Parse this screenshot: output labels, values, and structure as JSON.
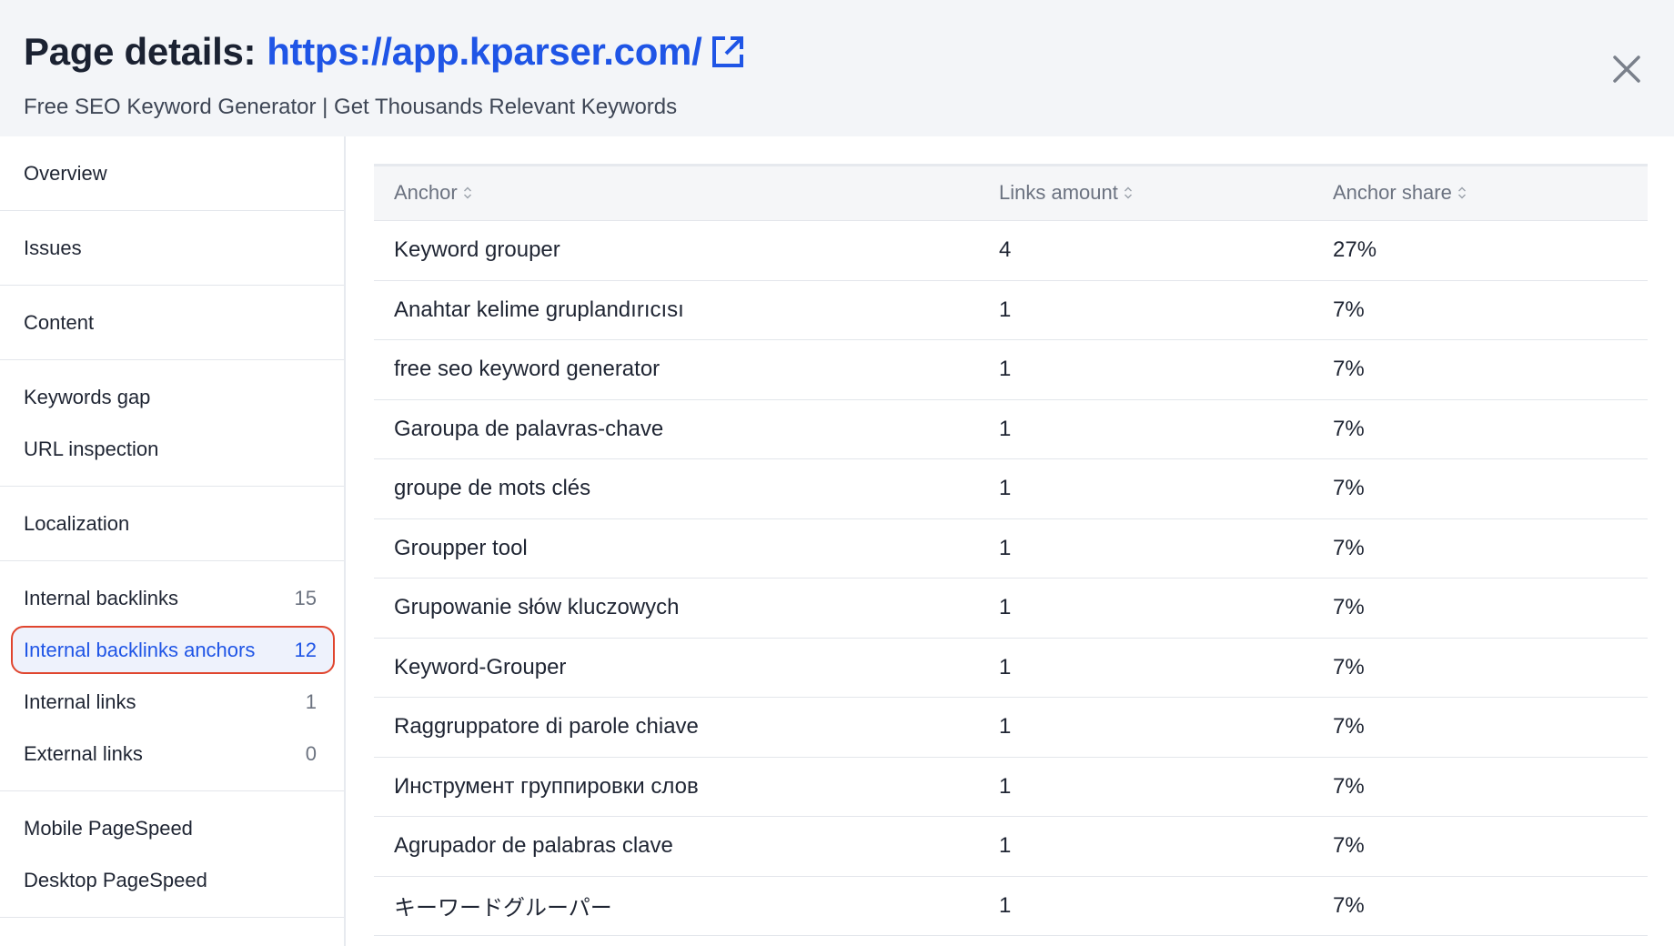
{
  "header": {
    "title_label": "Page details:",
    "url": "https://app.kparser.com/",
    "subtitle": "Free SEO Keyword Generator | Get Thousands Relevant Keywords"
  },
  "sidebar": {
    "groups": [
      [
        {
          "label": "Overview"
        }
      ],
      [
        {
          "label": "Issues"
        }
      ],
      [
        {
          "label": "Content"
        }
      ],
      [
        {
          "label": "Keywords gap"
        },
        {
          "label": "URL inspection"
        }
      ],
      [
        {
          "label": "Localization"
        }
      ],
      [
        {
          "label": "Internal backlinks",
          "count": "15"
        },
        {
          "label": "Internal backlinks anchors",
          "count": "12",
          "active": true
        },
        {
          "label": "Internal links",
          "count": "1"
        },
        {
          "label": "External links",
          "count": "0"
        }
      ],
      [
        {
          "label": "Mobile PageSpeed"
        },
        {
          "label": "Desktop PageSpeed"
        }
      ]
    ]
  },
  "table": {
    "columns": [
      "Anchor",
      "Links amount",
      "Anchor share"
    ],
    "rows": [
      [
        "Keyword grouper",
        "4",
        "27%"
      ],
      [
        "Anahtar kelime gruplandırıcısı",
        "1",
        "7%"
      ],
      [
        "free seo keyword generator",
        "1",
        "7%"
      ],
      [
        "Garoupa de palavras-chave",
        "1",
        "7%"
      ],
      [
        "groupe de mots clés",
        "1",
        "7%"
      ],
      [
        "Groupper tool",
        "1",
        "7%"
      ],
      [
        "Grupowanie słów kluczowych",
        "1",
        "7%"
      ],
      [
        "Keyword-Grouper",
        "1",
        "7%"
      ],
      [
        "Raggruppatore di parole chiave",
        "1",
        "7%"
      ],
      [
        "Инструмент группировки слов",
        "1",
        "7%"
      ],
      [
        "Agrupador de palabras clave",
        "1",
        "7%"
      ],
      [
        "キーワードグルーパー",
        "1",
        "7%"
      ]
    ]
  },
  "colors": {
    "accent": "#1f55e6",
    "highlight_border": "#e0452e",
    "header_bg": "#f3f5f8"
  }
}
